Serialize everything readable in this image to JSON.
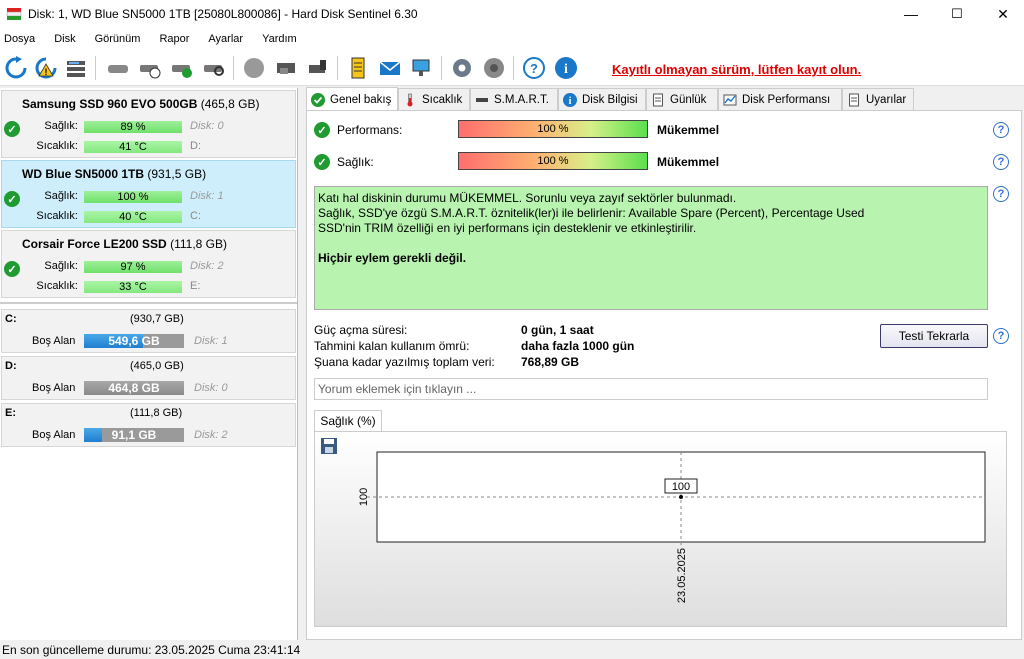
{
  "window": {
    "title": "Disk: 1, WD Blue SN5000 1TB [25080L800086]  -  Hard Disk Sentinel 6.30",
    "controls": {
      "minimize": "—",
      "maximize": "☐",
      "close": "✕"
    }
  },
  "menu": [
    "Dosya",
    "Disk",
    "Görünüm",
    "Rapor",
    "Ayarlar",
    "Yardım"
  ],
  "toolbar": {
    "icons": [
      "refresh-icon",
      "refresh-warning-icon",
      "disk-list-icon",
      "disk-gray-icon",
      "disk-clock-icon",
      "disk-check-icon",
      "disk-search-icon",
      "hdd-sphere-icon",
      "disk-tools-icon",
      "disk-add-icon",
      "report-icon",
      "mail-icon",
      "network-icon",
      "settings-icon",
      "speaker-icon",
      "help-icon",
      "info-icon"
    ],
    "register_message": "Kayıtlı olmayan sürüm, lütfen kayıt olun."
  },
  "disks": [
    {
      "name": "Samsung SSD 960 EVO 500GB",
      "size": "(465,8 GB)",
      "health_label": "Sağlık:",
      "health": "89 %",
      "health_pct": 89,
      "temp_label": "Sıcaklık:",
      "temp": "41 °C",
      "disk_note": "Disk: 0",
      "drive_note": "D:"
    },
    {
      "name": "WD Blue SN5000 1TB",
      "size": "(931,5 GB)",
      "health_label": "Sağlık:",
      "health": "100 %",
      "health_pct": 100,
      "temp_label": "Sıcaklık:",
      "temp": "40 °C",
      "disk_note": "Disk: 1",
      "drive_note": "C:"
    },
    {
      "name": "Corsair Force LE200 SSD",
      "size": "(111,8 GB)",
      "health_label": "Sağlık:",
      "health": "97 %",
      "health_pct": 97,
      "temp_label": "Sıcaklık:",
      "temp": "33 °C",
      "disk_note": "Disk: 2",
      "drive_note": "E:"
    }
  ],
  "volumes": [
    {
      "letter": "C:",
      "size": "(930,7 GB)",
      "free_label": "Boş Alan",
      "free": "549,6 GB",
      "free_pct": 59,
      "disk_note": "Disk: 1"
    },
    {
      "letter": "D:",
      "size": "(465,0 GB)",
      "free_label": "Boş Alan",
      "free": "464,8 GB",
      "free_pct": 100,
      "disk_note": "Disk: 0"
    },
    {
      "letter": "E:",
      "size": "(111,8 GB)",
      "free_label": "Boş Alan",
      "free": "91,1 GB",
      "free_pct": 18,
      "disk_note": "Disk: 2"
    }
  ],
  "tabs": [
    "Genel bakış",
    "Sıcaklık",
    "S.M.A.R.T.",
    "Disk Bilgisi",
    "Günlük",
    "Disk Performansı",
    "Uyarılar"
  ],
  "overview": {
    "performance_label": "Performans:",
    "performance_value": "100 %",
    "performance_rating": "Mükemmel",
    "health_label": "Sağlık:",
    "health_value": "100 %",
    "health_rating": "Mükemmel",
    "info_lines": [
      "Katı hal diskinin durumu MÜKEMMEL. Sorunlu veya zayıf sektörler bulunmadı.",
      "Sağlık, SSD'ye özgü S.M.A.R.T. öznitelik(ler)i ile belirlenir:  Available Spare (Percent), Percentage Used",
      "SSD'nin TRIM özelliği en iyi performans için desteklenir ve etkinleştirilir."
    ],
    "info_action": "Hiçbir eylem gerekli değil.",
    "power_on_label": "Güç açma süresi:",
    "power_on_value": "0 gün, 1 saat",
    "remaining_label": "Tahmini kalan kullanım ömrü:",
    "remaining_value": "daha fazla 1000 gün",
    "written_label": "Şuana kadar yazılmış toplam veri:",
    "written_value": "768,89 GB",
    "retest_button": "Testi Tekrarla",
    "comment_placeholder": "Yorum eklemek için tıklayın ..."
  },
  "chart_tab": "Sağlık (%)",
  "chart_data": {
    "type": "line",
    "x": [
      "23.05.2025"
    ],
    "series": [
      {
        "values": [
          100
        ]
      }
    ],
    "data_labels": [
      "100"
    ],
    "y_tick_labels": [
      "100"
    ]
  },
  "status": "En son güncelleme durumu: 23.05.2025 Cuma 23:41:14"
}
